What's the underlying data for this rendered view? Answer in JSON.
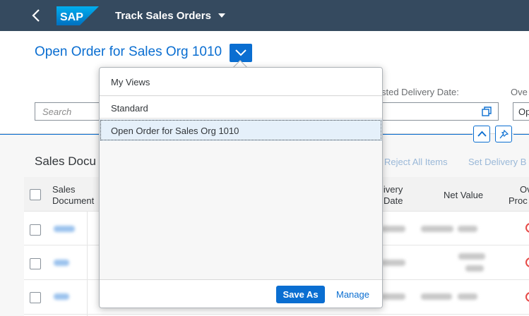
{
  "shell": {
    "app_title": "Track Sales Orders",
    "logo_text": "SAP"
  },
  "header": {
    "variant_title": "Open Order for Sales Org 1010",
    "search_placeholder": "Search",
    "requested_delivery_label": "sted Delivery Date:",
    "overall_label": "Ove",
    "overall_value": "Op"
  },
  "table": {
    "title": "Sales Docu",
    "toolbar": {
      "reject_all": "Reject All Items",
      "set_delivery": "Set Delivery B"
    },
    "columns": {
      "sales_document_1": "Sales",
      "sales_document_2": "Document",
      "delivery_1": "livery",
      "delivery_2": "Date",
      "net_value": "Net Value",
      "overall_1": "Ov",
      "overall_2": "Proc"
    },
    "row_count": 3
  },
  "variant_popover": {
    "header": "My Views",
    "items": [
      "Standard",
      "Open Order for Sales Org 1010"
    ],
    "selected_index": 1,
    "save_as_label": "Save As",
    "manage_label": "Manage"
  },
  "colors": {
    "shell_bg": "#354a5f",
    "accent": "#0a6ed1",
    "selected_item_bg": "#e5f0fa",
    "status_error": "#e64a46"
  },
  "icons": [
    "back-arrow-icon",
    "sap-logo",
    "chevron-down-icon",
    "value-help-icon",
    "collapse-header-icon",
    "pin-icon"
  ]
}
